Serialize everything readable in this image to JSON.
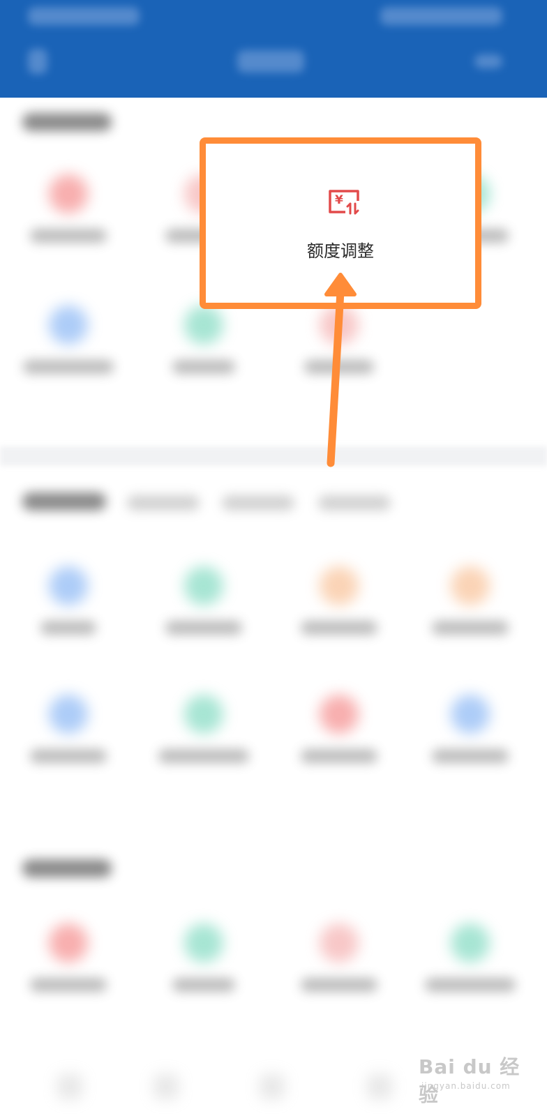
{
  "highlighted_item": {
    "label": "额度调整",
    "icon": "yuan-adjust-icon",
    "icon_color": "#e24a4a"
  },
  "annotation": {
    "color": "#ff8c38"
  },
  "watermark": {
    "brand": "Bai du 经验",
    "url": "jingyan.baidu.com"
  }
}
